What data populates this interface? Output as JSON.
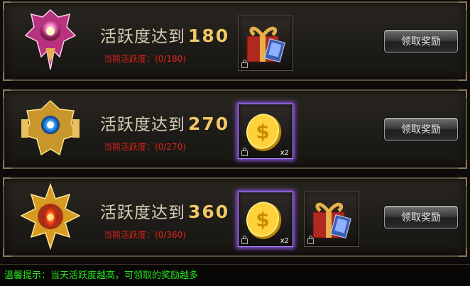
{
  "rows": [
    {
      "title": "活跃度达到",
      "target": "180",
      "progress": "当前活跃度：(0/180)",
      "button": "领取奖励",
      "rewards": [
        {
          "icon": "gift-box-icon",
          "qty": ""
        }
      ]
    },
    {
      "title": "活跃度达到",
      "target": "270",
      "progress": "当前活跃度：(0/270)",
      "button": "领取奖励",
      "rewards": [
        {
          "icon": "gold-coin-icon",
          "qty": "x2"
        }
      ]
    },
    {
      "title": "活跃度达到",
      "target": "360",
      "progress": "当前活跃度：(0/360)",
      "button": "领取奖励",
      "rewards": [
        {
          "icon": "gold-coin-icon",
          "qty": "x2"
        },
        {
          "icon": "gift-box-icon",
          "qty": ""
        }
      ]
    }
  ],
  "tip": "温馨提示：当天活跃度越高，可领取的奖励越多",
  "colors": {
    "title": "#d6cdb6",
    "number": "#f0c667",
    "progress": "#e0241f",
    "tip": "#27e31f",
    "glow": "#9b5bff"
  }
}
